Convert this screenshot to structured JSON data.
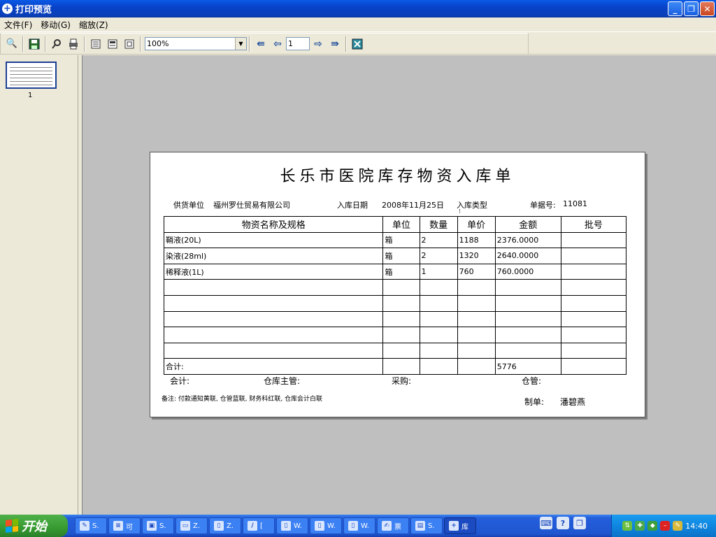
{
  "window": {
    "title": "打印预览"
  },
  "menu": [
    "文件(F)",
    "移动(G)",
    "缩放(Z)"
  ],
  "toolbar": {
    "zoom_value": "100%",
    "page_value": "1"
  },
  "thumbnail": {
    "page_label": "1"
  },
  "document": {
    "title": "长乐市医院库存物资入库单",
    "supplier_label": "供货单位",
    "supplier": "福州罗仕贸易有限公司",
    "date_label": "入库日期",
    "date": "2008年11月25日",
    "type_label": "入库类型",
    "doc_no_label": "单据号:",
    "doc_no": "11081",
    "columns": [
      "物资名称及规格",
      "单位",
      "数量",
      "单价",
      "金额",
      "批号"
    ],
    "rows": [
      [
        "鞘液(20L)",
        "箱",
        "2",
        "1188",
        "2376.0000",
        ""
      ],
      [
        "染液(28ml)",
        "箱",
        "2",
        "1320",
        "2640.0000",
        ""
      ],
      [
        "稀释液(1L)",
        "箱",
        "1",
        "760",
        "760.0000",
        ""
      ],
      [
        "",
        "",
        "",
        "",
        "",
        ""
      ],
      [
        "",
        "",
        "",
        "",
        "",
        ""
      ],
      [
        "",
        "",
        "",
        "",
        "",
        ""
      ],
      [
        "",
        "",
        "",
        "",
        "",
        ""
      ],
      [
        "",
        "",
        "",
        "",
        "",
        ""
      ]
    ],
    "total_label": "合计:",
    "total_amount": "5776",
    "sign_accountant": "会计:",
    "sign_warehouse_head": "仓库主管:",
    "sign_purchase": "采购:",
    "sign_keeper": "仓管:",
    "note": "备注: 付款通知黄联, 仓管蓝联, 财务科红联, 仓库会计白联",
    "maker_label": "制单:",
    "maker": "潘碧燕"
  },
  "taskbar": {
    "start_label": "开始",
    "tasks": [
      "S.",
      "可",
      "S.",
      "Z.",
      "Z.",
      "[",
      "W.",
      "W.",
      "W.",
      "票",
      "S.",
      "库"
    ],
    "clock": "14:40"
  },
  "colors": {
    "titlebar": "#0a4ad8",
    "preview_bg": "#bfbfbf",
    "taskbar": "#245edb",
    "start": "#379a31"
  }
}
